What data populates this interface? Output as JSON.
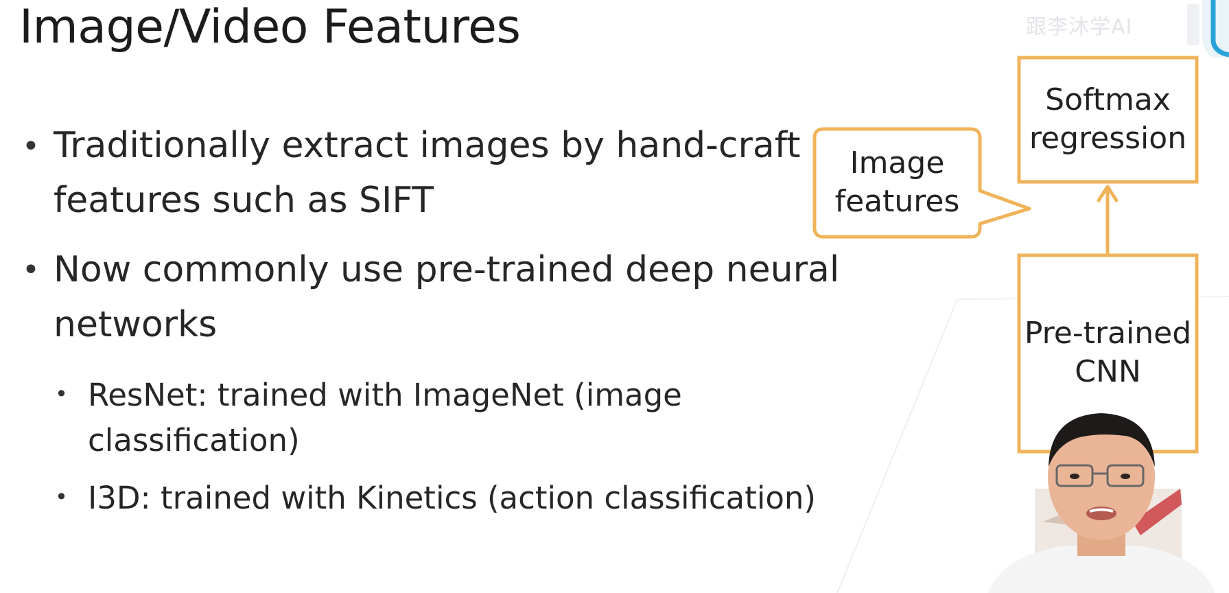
{
  "slide": {
    "title": "Image/Video Features",
    "bullets": [
      {
        "lines": [
          "Traditionally extract images by hand-craft",
          "features such as SIFT"
        ]
      },
      {
        "lines": [
          "Now commonly use pre-trained deep neural",
          "networks"
        ]
      }
    ],
    "sub_bullets": [
      {
        "lines": [
          "ResNet: trained with ImageNet (image",
          "classification)"
        ]
      },
      {
        "lines": [
          "I3D: trained with Kinetics (action classification)"
        ]
      }
    ]
  },
  "diagram": {
    "softmax_box": {
      "line1": "Softmax",
      "line2": "regression"
    },
    "features_callout": {
      "line1": "Image",
      "line2": "features"
    },
    "cnn_box": {
      "line1": "Pre-trained",
      "line2": "CNN"
    }
  },
  "watermark": {
    "text": "跟李沐学AI"
  },
  "colors": {
    "accent_orange": "#f0b35a",
    "text": "#262626",
    "background": "#ffffff"
  },
  "icons": {
    "bullet": "bullet-dot",
    "arrow": "arrow-up-icon",
    "logo": "bilibili-logo"
  }
}
